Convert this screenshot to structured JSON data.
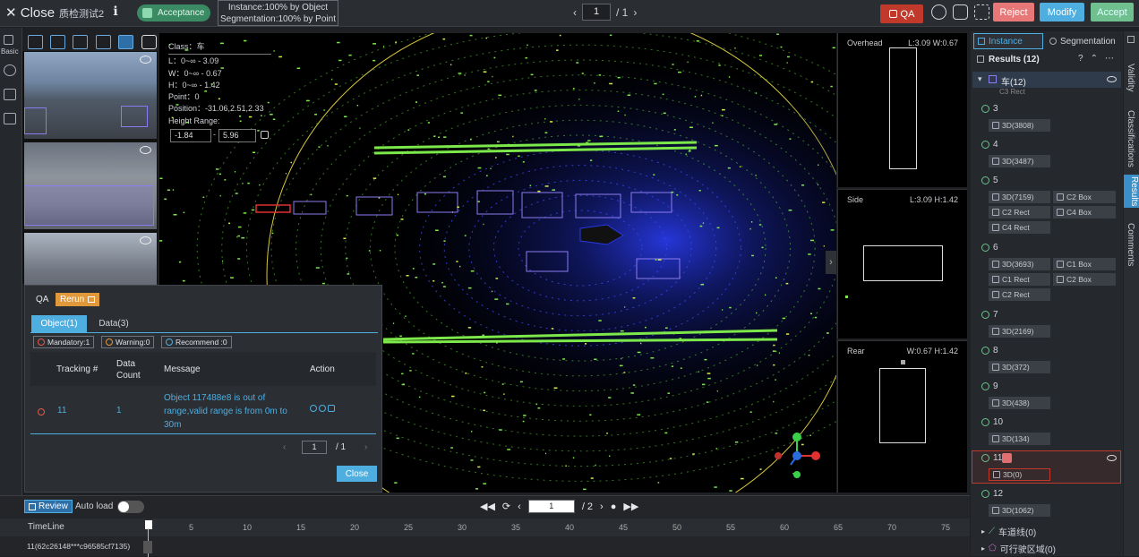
{
  "topbar": {
    "close_label": "Close",
    "task_name": "质检测试2",
    "status_badge": "Acceptance",
    "progress_instance": "Instance:100% by Object",
    "progress_segmentation": "Segmentation:100% by Point",
    "page_current": "1",
    "page_total": "/ 1",
    "qa_label": "QA",
    "reject_label": "Reject",
    "modify_label": "Modify",
    "accept_label": "Accept"
  },
  "left_strip": {
    "basic_label": "Basic"
  },
  "info_panel": {
    "class_line": "Class：车",
    "l_line": "L：0~∞ - 3.09",
    "w_line": "W：0~∞ - 0.67",
    "h_line": "H：0~∞ - 1.42",
    "point_line": "Point：0",
    "position_line": "Position：-31.06,2.51,2.33",
    "height_range_label": "Height Range:",
    "height_min": "-1.84",
    "height_max": "5.96"
  },
  "side_views": {
    "overhead_label": "Overhead",
    "overhead_dims": "L:3.09 W:0.67",
    "side_label": "Side",
    "side_dims": "L:3.09 H:1.42",
    "rear_label": "Rear",
    "rear_dims": "W:0.67 H:1.42"
  },
  "qa_panel": {
    "title": "QA",
    "rerun_label": "Rerun",
    "tab_object": "Object(1)",
    "tab_data": "Data(3)",
    "chip_mandatory": "Mandatory:1",
    "chip_warning": "Warning:0",
    "chip_recommend": "Recommend :0",
    "col_tracking": "Tracking #",
    "col_data_count_1": "Data",
    "col_data_count_2": "Count",
    "col_message": "Message",
    "col_action": "Action",
    "row_tracking": "11",
    "row_count": "1",
    "row_message": "Object 117488e8 is out of range,valid range is from 0m to 30m",
    "pager_current": "1",
    "pager_total": "/ 1",
    "close_label": "Close"
  },
  "bottom": {
    "review_label": "Review",
    "autoload_label": "Auto load",
    "frame_current": "1",
    "frame_total": "/ 2",
    "timeline_label": "TimeLine",
    "ticks": [
      "5",
      "10",
      "15",
      "20",
      "25",
      "30",
      "35",
      "40",
      "45",
      "50",
      "55",
      "60",
      "65",
      "70",
      "75"
    ],
    "track_label": "11(62c26148***c96585cf7135)"
  },
  "right_panel": {
    "tab_instance": "Instance",
    "tab_segmentation": "Segmentation",
    "results_label": "Results (12)",
    "group_label": "车(12)",
    "clipped_item": "C3 Rect",
    "entries": [
      {
        "id": "3",
        "items": [
          "3D(3808)"
        ]
      },
      {
        "id": "4",
        "items": [
          "3D(3487)"
        ]
      },
      {
        "id": "5",
        "items": [
          "3D(7159)",
          "C2 Box",
          "C2 Rect",
          "C4 Box",
          "C4 Rect"
        ]
      },
      {
        "id": "6",
        "items": [
          "3D(3693)",
          "C1 Box",
          "C1 Rect",
          "C2 Box",
          "C2 Rect"
        ]
      },
      {
        "id": "7",
        "items": [
          "3D(2169)"
        ]
      },
      {
        "id": "8",
        "items": [
          "3D(372)"
        ]
      },
      {
        "id": "9",
        "items": [
          "3D(438)"
        ]
      },
      {
        "id": "10",
        "items": [
          "3D(134)"
        ]
      },
      {
        "id": "11",
        "items": [
          "3D(0)"
        ]
      },
      {
        "id": "12",
        "items": [
          "3D(1062)"
        ]
      }
    ],
    "lane_label": "车道线(0)",
    "drivable_label": "可行驶区域(0)"
  },
  "vertical_tabs": {
    "validity": "Validity",
    "classifications": "Classifications",
    "results": "Results",
    "comments": "Comments"
  },
  "colors": {
    "accent": "#4eaee0",
    "points_green": "#7de84a",
    "points_blue": "#2838e0",
    "box_purple": "#8c7cf0",
    "warning_red": "#c0392b"
  }
}
